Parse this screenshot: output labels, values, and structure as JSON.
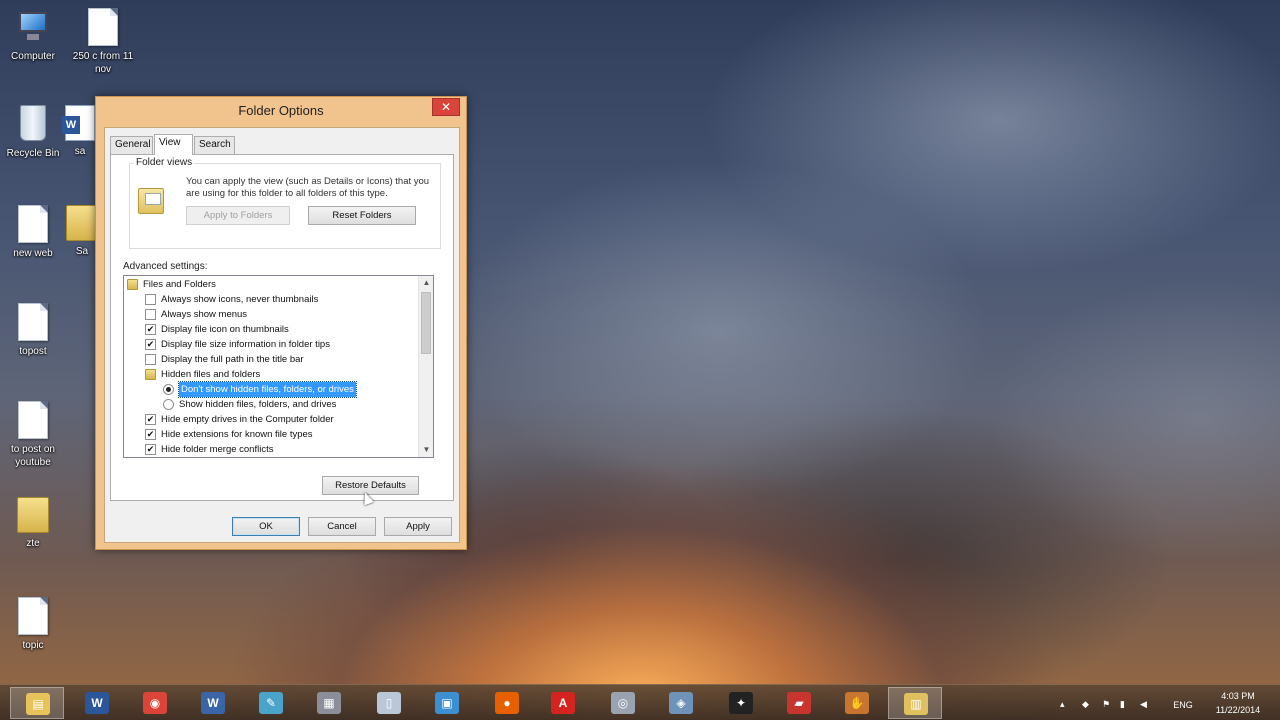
{
  "desktop": {
    "icons": [
      {
        "label": "Computer",
        "icon": "computer-icon"
      },
      {
        "label": "250 c from 11 nov",
        "icon": "document-icon"
      },
      {
        "label": "Recycle Bin",
        "icon": "recycle-bin-icon"
      },
      {
        "label": "sa",
        "icon": "word-document-icon"
      },
      {
        "label": "new web",
        "icon": "document-icon"
      },
      {
        "label": "Sa",
        "icon": "folder-icon"
      },
      {
        "label": "topost",
        "icon": "document-icon"
      },
      {
        "label": "to post on youtube",
        "icon": "document-icon"
      },
      {
        "label": "zte",
        "icon": "folder-icon"
      },
      {
        "label": "topic",
        "icon": "document-icon"
      }
    ]
  },
  "dialog": {
    "title": "Folder Options",
    "close_glyph": "✕",
    "tabs": [
      {
        "label": "General",
        "active": false
      },
      {
        "label": "View",
        "active": true
      },
      {
        "label": "Search",
        "active": false
      }
    ],
    "folder_views": {
      "label": "Folder views",
      "description": "You can apply the view (such as Details or Icons) that you are using for this folder to all folders of this type.",
      "apply_label": "Apply to Folders",
      "reset_label": "Reset Folders"
    },
    "advanced_label": "Advanced settings:",
    "tree": [
      {
        "type": "folder",
        "label": "Files and Folders",
        "indent": 0
      },
      {
        "type": "checkbox",
        "checked": false,
        "label": "Always show icons, never thumbnails",
        "indent": 1
      },
      {
        "type": "checkbox",
        "checked": false,
        "label": "Always show menus",
        "indent": 1
      },
      {
        "type": "checkbox",
        "checked": true,
        "label": "Display file icon on thumbnails",
        "indent": 1
      },
      {
        "type": "checkbox",
        "checked": true,
        "label": "Display file size information in folder tips",
        "indent": 1
      },
      {
        "type": "checkbox",
        "checked": false,
        "label": "Display the full path in the title bar",
        "indent": 1
      },
      {
        "type": "folder",
        "label": "Hidden files and folders",
        "indent": 1
      },
      {
        "type": "radio",
        "checked": true,
        "selected": true,
        "label": "Don't show hidden files, folders, or drives",
        "indent": 2
      },
      {
        "type": "radio",
        "checked": false,
        "label": "Show hidden files, folders, and drives",
        "indent": 2
      },
      {
        "type": "checkbox",
        "checked": true,
        "label": "Hide empty drives in the Computer folder",
        "indent": 1
      },
      {
        "type": "checkbox",
        "checked": true,
        "label": "Hide extensions for known file types",
        "indent": 1
      },
      {
        "type": "checkbox",
        "checked": true,
        "label": "Hide folder merge conflicts",
        "indent": 1
      }
    ],
    "restore_label": "Restore Defaults",
    "ok_label": "OK",
    "cancel_label": "Cancel",
    "apply_label": "Apply"
  },
  "taskbar": {
    "items": [
      {
        "icon": "file-explorer-icon",
        "glyph": "▤",
        "color": "#e8c35a",
        "active": true
      },
      {
        "icon": "word-icon",
        "glyph": "W",
        "color": "#2b579a",
        "active": false
      },
      {
        "icon": "chrome-icon",
        "glyph": "◉",
        "color": "#db4437",
        "active": false
      },
      {
        "icon": "word-document-icon",
        "glyph": "W",
        "color": "#3a66a8",
        "active": false
      },
      {
        "icon": "notepad-icon",
        "glyph": "✎",
        "color": "#4aa3c8",
        "active": false
      },
      {
        "icon": "paint-icon",
        "glyph": "▦",
        "color": "#8a8f99",
        "active": false
      },
      {
        "icon": "document-icon",
        "glyph": "▯",
        "color": "#b9c7d8",
        "active": false
      },
      {
        "icon": "network-icon",
        "glyph": "▣",
        "color": "#3c8fd1",
        "active": false
      },
      {
        "icon": "firefox-icon",
        "glyph": "●",
        "color": "#e66000",
        "active": false
      },
      {
        "icon": "acrobat-icon",
        "glyph": "A",
        "color": "#d5231f",
        "active": false
      },
      {
        "icon": "webcam-icon",
        "glyph": "◎",
        "color": "#9aa4b0",
        "active": false
      },
      {
        "icon": "media-icon",
        "glyph": "◈",
        "color": "#6f93b8",
        "active": false
      },
      {
        "icon": "runner-icon",
        "glyph": "✦",
        "color": "#222222",
        "active": false
      },
      {
        "icon": "toolbox-icon",
        "glyph": "▰",
        "color": "#c8352f",
        "active": false
      },
      {
        "icon": "glove-icon",
        "glyph": "✋",
        "color": "#c8752f",
        "active": false
      },
      {
        "icon": "folder-options-icon",
        "glyph": "▥",
        "color": "#e1c15e",
        "active": true
      }
    ],
    "language": "ENG",
    "time": "4:03 PM",
    "date": "11/22/2014"
  }
}
